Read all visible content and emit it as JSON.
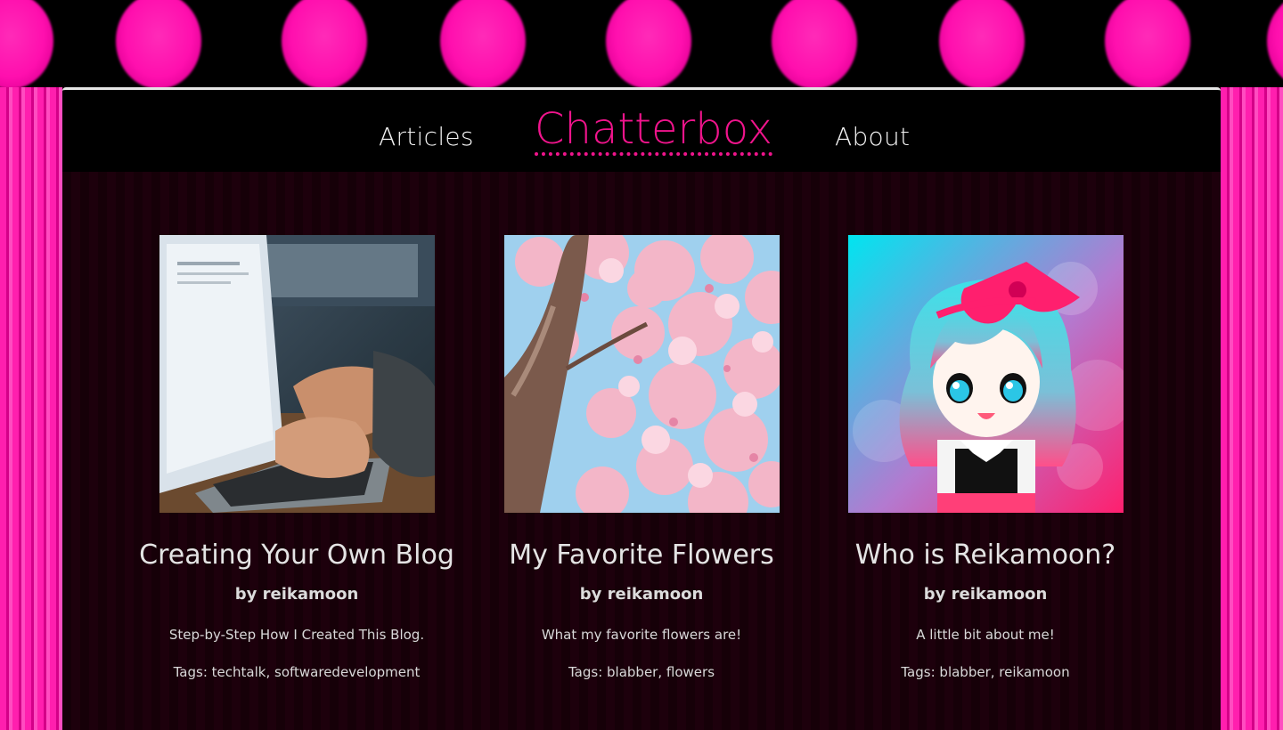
{
  "colors": {
    "accent_pink": "#f0148c",
    "header_bg": "#000000",
    "panel_bg": "#160008",
    "stripe_pink": "#ff1fae",
    "text_light": "#e4e4e4"
  },
  "nav": {
    "left_label": "Articles",
    "brand": "Chatterbox",
    "right_label": "About"
  },
  "cards": [
    {
      "image_name": "laptop-typing-photo",
      "title": "Creating Your Own Blog",
      "author": "by reikamoon",
      "description": "Step-by-Step How I Created This Blog.",
      "tags_label": "Tags:",
      "tags": [
        "techtalk",
        "softwaredevelopment"
      ]
    },
    {
      "image_name": "cherry-blossom-photo",
      "title": "My Favorite Flowers",
      "author": "by reikamoon",
      "description": "What my favorite flowers are!",
      "tags_label": "Tags:",
      "tags": [
        "blabber",
        "flowers"
      ]
    },
    {
      "image_name": "anime-avatar-illustration",
      "title": "Who is Reikamoon?",
      "author": "by reikamoon",
      "description": "A little bit about me!",
      "tags_label": "Tags:",
      "tags": [
        "blabber",
        "reikamoon"
      ]
    }
  ]
}
